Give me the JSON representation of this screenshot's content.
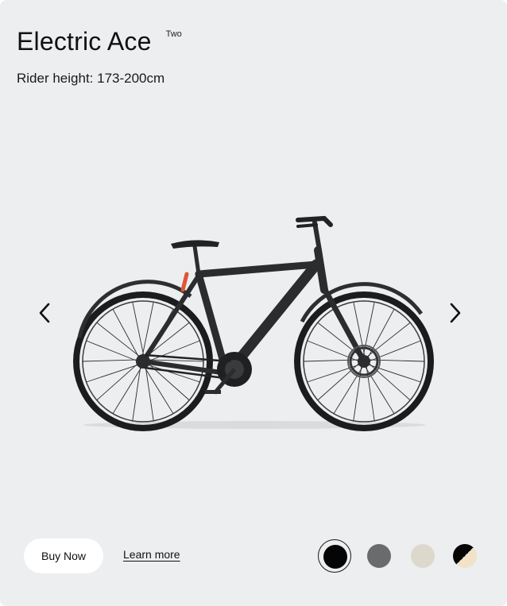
{
  "product": {
    "name": "Electric Ace",
    "variant_tag": "Two",
    "rider_height": "Rider height: 173-200cm"
  },
  "actions": {
    "buy_label": "Buy Now",
    "learn_label": "Learn more"
  },
  "colors": {
    "card_bg": "#eceef0",
    "frame": "#2b2c2e",
    "accent": "#e0553a"
  },
  "swatches": [
    {
      "name": "black",
      "color": "#050505",
      "selected": true
    },
    {
      "name": "grey",
      "color": "#6a6b6d",
      "selected": false
    },
    {
      "name": "sand",
      "color": "#ddd8cc",
      "selected": false
    },
    {
      "name": "black-cream",
      "color": "#050505",
      "color2": "#f2e2c8",
      "selected": false
    }
  ],
  "icons": {
    "prev": "chevron-left-icon",
    "next": "chevron-right-icon"
  }
}
